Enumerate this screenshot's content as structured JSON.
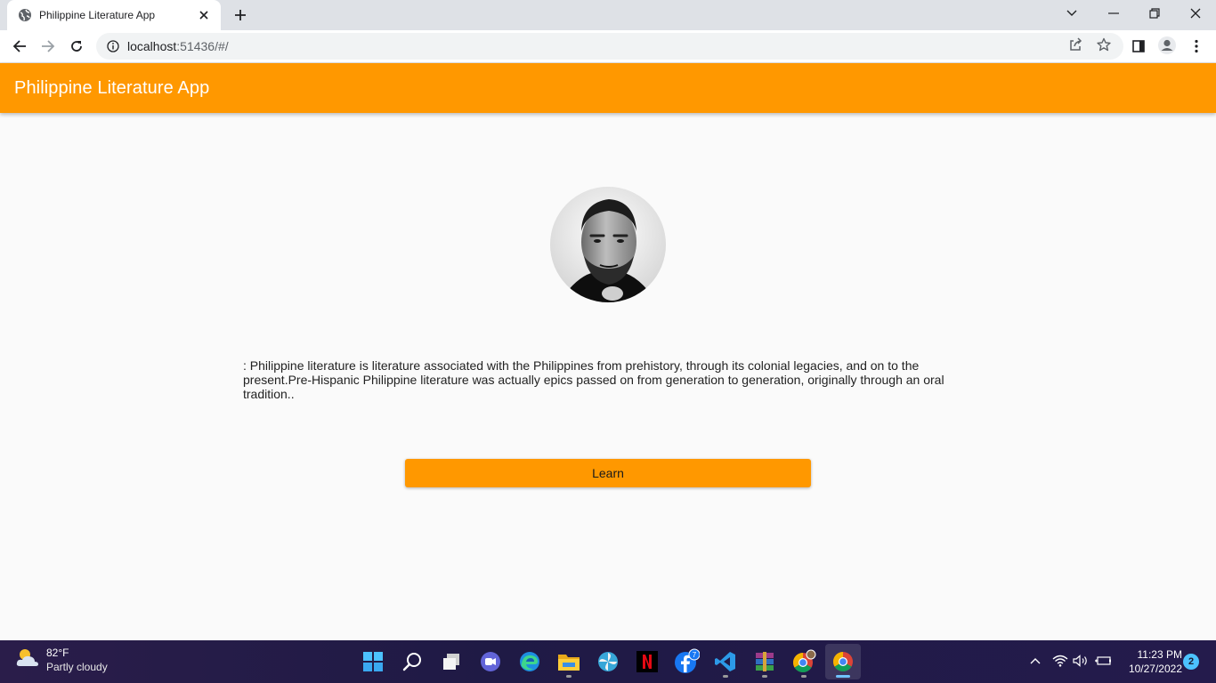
{
  "browser": {
    "tab_title": "Philippine Literature App",
    "url_host": "localhost",
    "url_rest": ":51436/#/"
  },
  "app": {
    "title": "Philippine Literature App",
    "description": ": Philippine literature is literature associated with the Philippines from prehistory, through its colonial legacies, and on to the present.Pre-Hispanic Philippine literature was actually epics passed on from generation to generation, originally through an oral tradition..",
    "button_label": "Learn",
    "accent_color": "#ff9800"
  },
  "taskbar": {
    "weather_temp": "82°F",
    "weather_condition": "Partly cloudy",
    "time": "11:23 PM",
    "date": "10/27/2022",
    "notification_count": "2",
    "facebook_badge": "7",
    "apps": [
      "start",
      "search",
      "task-view",
      "chat",
      "edge",
      "file-explorer",
      "pinwheel",
      "netflix",
      "facebook",
      "vscode",
      "winrar",
      "chrome-profile",
      "chrome"
    ]
  }
}
